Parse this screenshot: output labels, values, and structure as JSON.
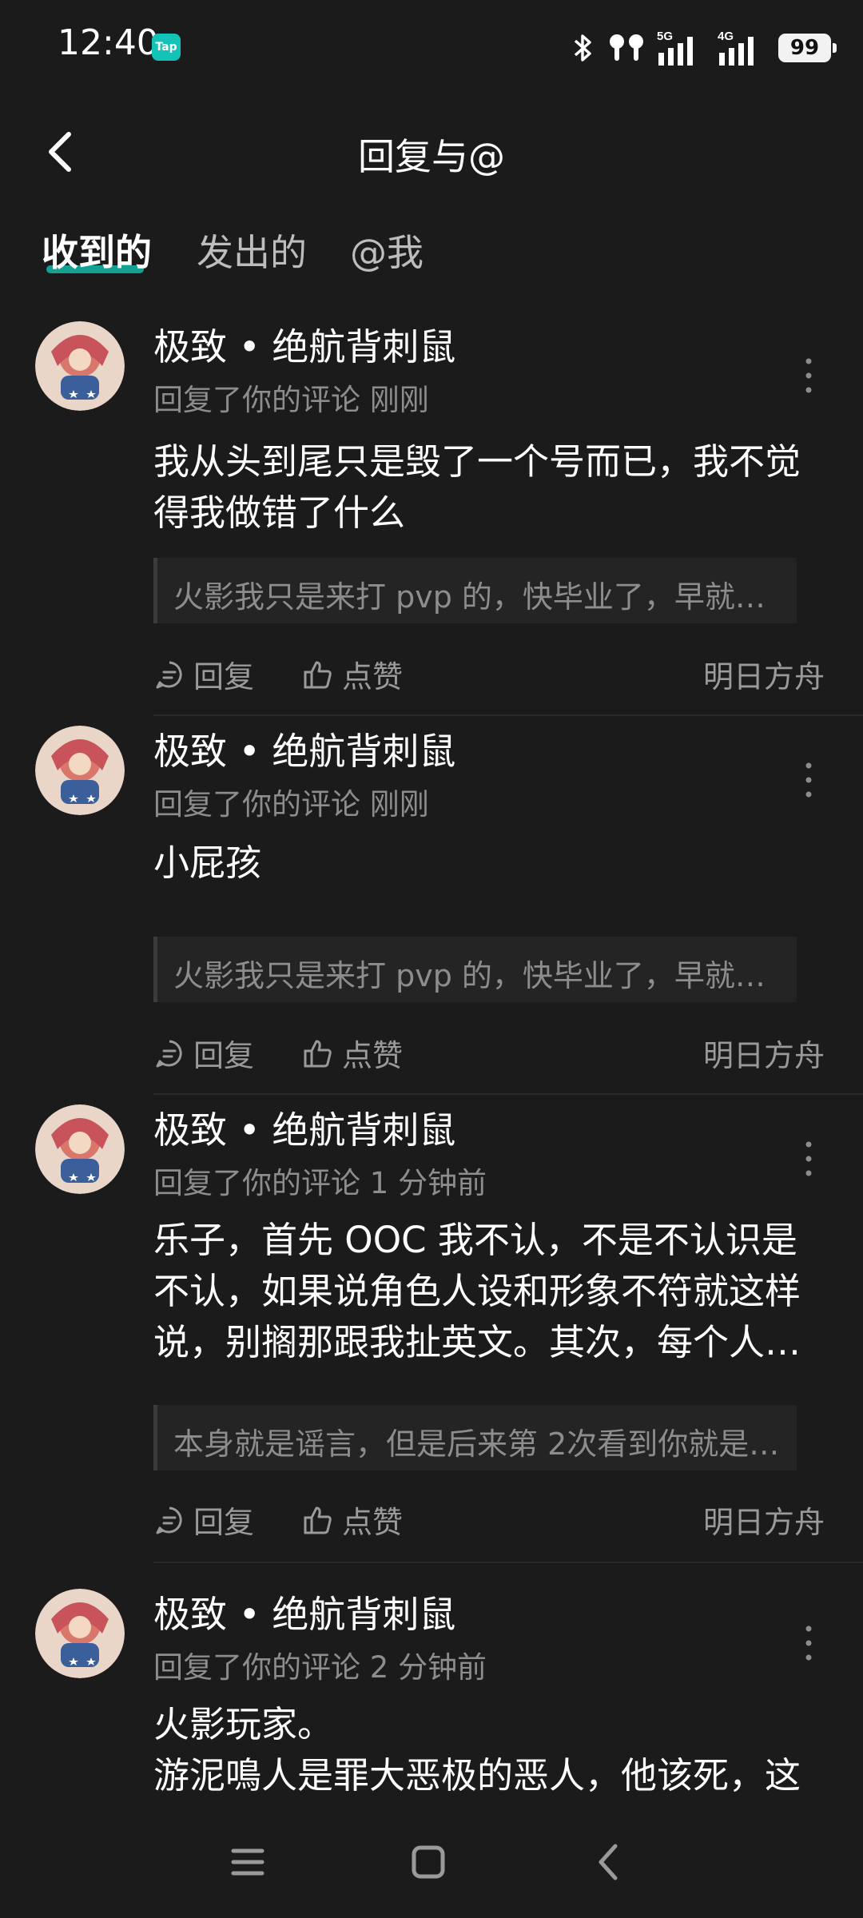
{
  "status_bar": {
    "time": "12:40",
    "app_icon_label": "Tap",
    "battery": "99",
    "network_5g": "5G",
    "network_4g": "4G"
  },
  "header": {
    "title": "回复与@"
  },
  "tabs": [
    {
      "label": "收到的",
      "active": true
    },
    {
      "label": "发出的",
      "active": false
    },
    {
      "label": "@我",
      "active": false
    }
  ],
  "comments": [
    {
      "author": "极致 • 绝航背刺鼠",
      "meta": "回复了你的评论 刚刚",
      "body_lines": [
        "我从头到尾只是毁了一个号而已，我不觉",
        "得我做错了什么"
      ],
      "quote": "火影我只是来打 pvp 的，快毕业了，早就快…",
      "reply_label": "回复",
      "like_label": "点赞",
      "game": "明日方舟"
    },
    {
      "author": "极致 • 绝航背刺鼠",
      "meta": "回复了你的评论 刚刚",
      "body_lines": [
        "小屁孩"
      ],
      "quote": "火影我只是来打 pvp 的，快毕业了，早就快…",
      "reply_label": "回复",
      "like_label": "点赞",
      "game": "明日方舟"
    },
    {
      "author": "极致 • 绝航背刺鼠",
      "meta": "回复了你的评论 1 分钟前",
      "body_lines": [
        "乐子，首先 OOC 我不认，不是不认识是",
        "不认，如果说角色人设和形象不符就这样",
        "说，别搁那跟我扯英文。其次，每个人…"
      ],
      "quote": "本身就是谣言，但是后来第 2次看到你就是…",
      "reply_label": "回复",
      "like_label": "点赞",
      "game": "明日方舟"
    },
    {
      "author": "极致 • 绝航背刺鼠",
      "meta": "回复了你的评论 2 分钟前",
      "body_lines": [
        "火影玩家。",
        "游泥鳴人是罪大恶极的恶人，他该死，这"
      ],
      "quote": "",
      "reply_label": "",
      "like_label": "",
      "game": ""
    }
  ],
  "colors": {
    "accent": "#14b8a6",
    "background": "#1b1b1b",
    "muted_text": "#8d8d8d"
  },
  "icons": {
    "back": "chevron-left-icon",
    "more": "more-vertical-icon",
    "reply": "comment-bubble-icon",
    "like": "thumbs-up-icon",
    "nav_menu": "menu-icon",
    "nav_home": "square-home-icon",
    "nav_back": "chevron-left-icon"
  }
}
